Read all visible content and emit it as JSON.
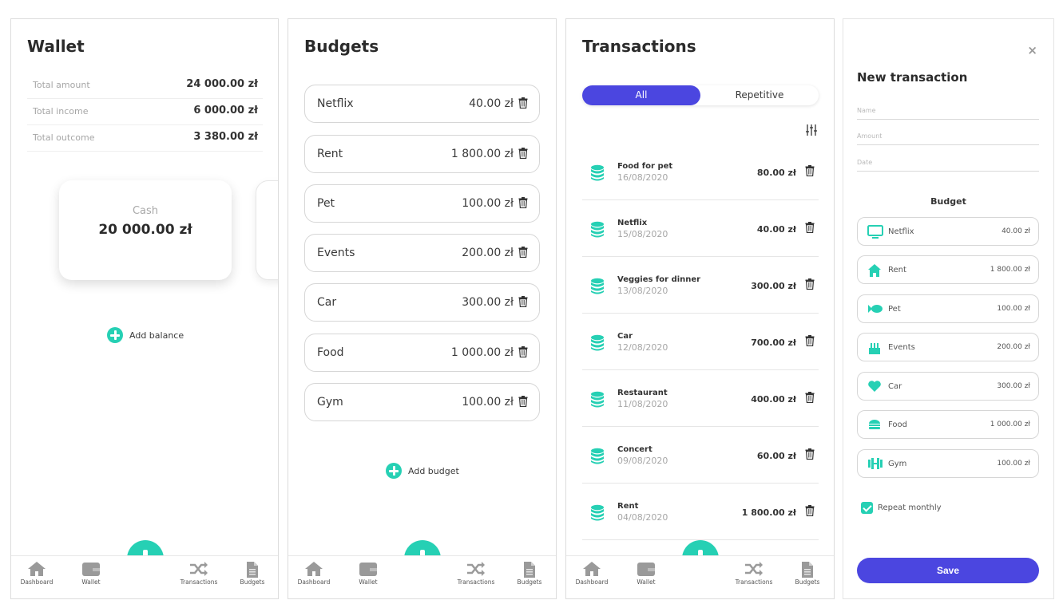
{
  "colors": {
    "accent": "#26d0b4",
    "primary": "#4b46e0",
    "text": "#2b2b2b",
    "muted": "#a6a6a6"
  },
  "nav": {
    "dashboard": "Dashboard",
    "wallet": "Wallet",
    "transactions": "Transactions",
    "budgets": "Budgets",
    "fab_icon": "plus-icon"
  },
  "wallet": {
    "title": "Wallet",
    "stats": [
      {
        "label": "Total amount",
        "value": "24 000.00 zł"
      },
      {
        "label": "Total income",
        "value": "6 000.00 zł"
      },
      {
        "label": "Total outcome",
        "value": "3 380.00 zł"
      }
    ],
    "card": {
      "label": "Cash",
      "value": "20 000.00 zł"
    },
    "add_balance": "Add balance"
  },
  "budgets": {
    "title": "Budgets",
    "items": [
      {
        "name": "Netflix",
        "amount": "40.00 zł"
      },
      {
        "name": "Rent",
        "amount": "1 800.00 zł"
      },
      {
        "name": "Pet",
        "amount": "100.00 zł"
      },
      {
        "name": "Events",
        "amount": "200.00 zł"
      },
      {
        "name": "Car",
        "amount": "300.00 zł"
      },
      {
        "name": "Food",
        "amount": "1 000.00 zł"
      },
      {
        "name": "Gym",
        "amount": "100.00 zł"
      }
    ],
    "add_budget": "Add budget"
  },
  "transactions": {
    "title": "Transactions",
    "tabs": {
      "all": "All",
      "repetitive": "Repetitive"
    },
    "items": [
      {
        "name": "Food for pet",
        "date": "16/08/2020",
        "amount": "80.00 zł"
      },
      {
        "name": "Netflix",
        "date": "15/08/2020",
        "amount": "40.00 zł"
      },
      {
        "name": "Veggies for dinner",
        "date": "13/08/2020",
        "amount": "300.00 zł"
      },
      {
        "name": "Car",
        "date": "12/08/2020",
        "amount": "700.00 zł"
      },
      {
        "name": "Restaurant",
        "date": "11/08/2020",
        "amount": "400.00 zł"
      },
      {
        "name": "Concert",
        "date": "09/08/2020",
        "amount": "60.00 zł"
      },
      {
        "name": "Rent",
        "date": "04/08/2020",
        "amount": "1 800.00 zł"
      }
    ]
  },
  "new_transaction": {
    "title": "New transaction",
    "close": "×",
    "fields": {
      "name": "Name",
      "amount": "Amount",
      "date": "Date"
    },
    "budget_header": "Budget",
    "options": [
      {
        "name": "Netflix",
        "amount": "40.00 zł",
        "icon": "monitor-icon"
      },
      {
        "name": "Rent",
        "amount": "1 800.00 zł",
        "icon": "house-icon"
      },
      {
        "name": "Pet",
        "amount": "100.00 zł",
        "icon": "fish-icon"
      },
      {
        "name": "Events",
        "amount": "200.00 zł",
        "icon": "cake-icon"
      },
      {
        "name": "Car",
        "amount": "300.00 zł",
        "icon": "heart-icon"
      },
      {
        "name": "Food",
        "amount": "1 000.00 zł",
        "icon": "burger-icon"
      },
      {
        "name": "Gym",
        "amount": "100.00 zł",
        "icon": "dumbbell-icon"
      }
    ],
    "repeat_label": "Repeat monthly",
    "repeat_checked": true,
    "save": "Save"
  }
}
